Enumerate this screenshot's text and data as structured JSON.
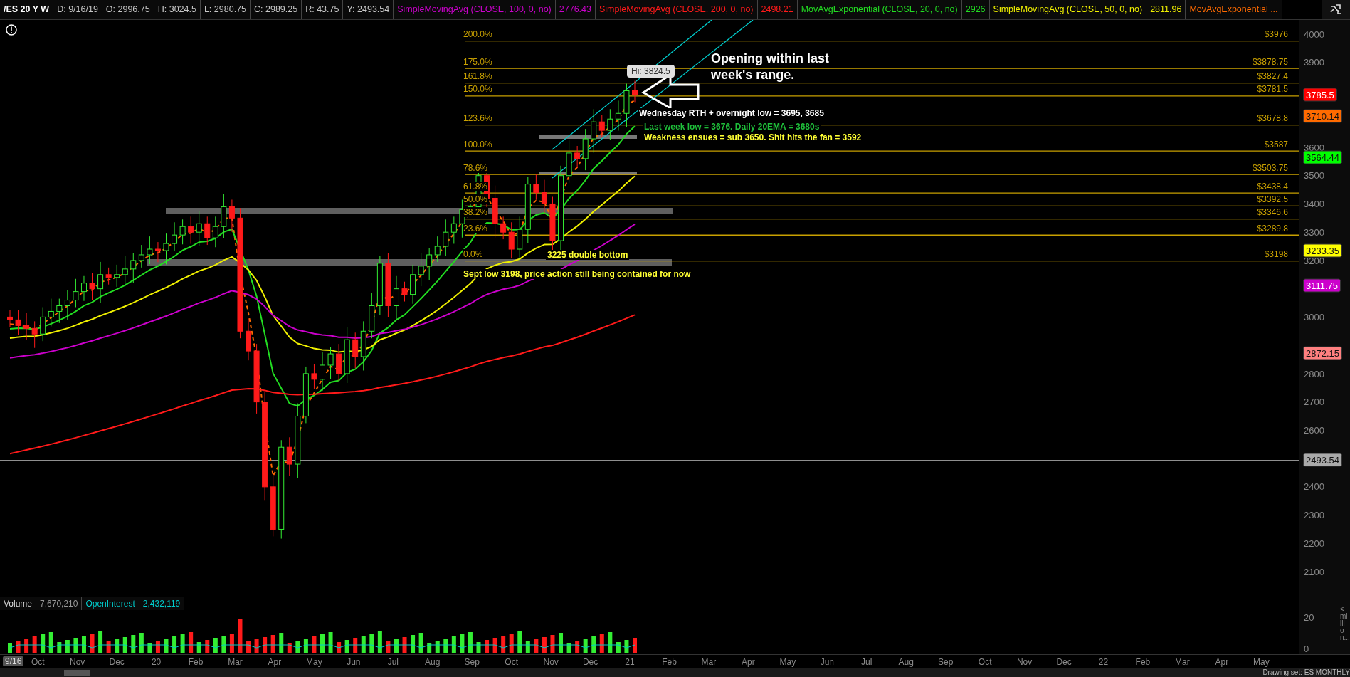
{
  "header": {
    "symbol": "/ES 20 Y W",
    "fields": [
      "D: 9/16/19",
      "O: 2996.75",
      "H: 3024.5",
      "L: 2980.75",
      "C: 2989.25",
      "R: 43.75",
      "Y: 2493.54"
    ],
    "studies": [
      {
        "name": "SimpleMovingAvg (CLOSE, 100, 0, no)",
        "value": "2776.43",
        "color": "#cc00cc"
      },
      {
        "name": "SimpleMovingAvg (CLOSE, 200, 0, no)",
        "value": "2498.21",
        "color": "#ff1a1a"
      },
      {
        "name": "MovAvgExponential (CLOSE, 20, 0, no)",
        "value": "2926",
        "color": "#22dd22"
      },
      {
        "name": "SimpleMovingAvg (CLOSE, 50, 0, no)",
        "value": "2811.96",
        "color": "#f0f000"
      },
      {
        "name": "MovAvgExponential ...",
        "color": "#ff6a00"
      }
    ]
  },
  "chart": {
    "fib_levels": [
      {
        "percent": "200.0%",
        "price": "$3976"
      },
      {
        "percent": "175.0%",
        "price": "$3878.75"
      },
      {
        "percent": "161.8%",
        "price": "$3827.4"
      },
      {
        "percent": "150.0%",
        "price": "$3781.5"
      },
      {
        "percent": "123.6%",
        "price": "$3678.8"
      },
      {
        "percent": "100.0%",
        "price": "$3587"
      },
      {
        "percent": "78.6%",
        "price": "$3503.75"
      },
      {
        "percent": "61.8%",
        "price": "$3438.4"
      },
      {
        "percent": "50.0%",
        "price": "$3392.5"
      },
      {
        "percent": "38.2%",
        "price": "$3346.6"
      },
      {
        "percent": "23.6%",
        "price": "$3289.8"
      },
      {
        "percent": "0.0%",
        "price": "$3198"
      }
    ],
    "price_ticks": [
      "4000",
      "3900",
      "3600",
      "3500",
      "3400",
      "3300",
      "3200",
      "3000",
      "2800",
      "2700",
      "2600",
      "2400",
      "2300",
      "2200",
      "2100"
    ],
    "price_tags": [
      {
        "text": "3785.5",
        "color": "#ff0000",
        "kind": "study"
      },
      {
        "text": "3710.14",
        "color": "#ff6a00",
        "kind": "study"
      },
      {
        "text": "3564.44",
        "color": "#00ff00",
        "kind": "study"
      },
      {
        "text": "3233.35",
        "color": "#ffff00",
        "kind": "study"
      },
      {
        "text": "3111.75",
        "color": "#cc00cc",
        "kind": "study"
      },
      {
        "text": "2872.15",
        "color": "#ff8080",
        "kind": "study"
      },
      {
        "text": "2493.54",
        "color": "#aaaaaa",
        "kind": "price-line"
      }
    ],
    "annotations": [
      {
        "text": "Hi: 3824.5",
        "kind": "bubble",
        "color": "#e0e0e0"
      },
      {
        "text": "Opening within last week's range.",
        "kind": "headline",
        "color": "#ffffff"
      },
      {
        "text": "Wednesday RTH + overnight low = 3695, 3685",
        "kind": "note",
        "color": "#ffffff"
      },
      {
        "text": "Last week low = 3676. Daily 20EMA = 3680s",
        "kind": "note",
        "color": "#1fbf3a"
      },
      {
        "text": "Weakness ensues = sub 3650. Shit hits the fan = 3592",
        "kind": "note",
        "color": "#ffff33"
      },
      {
        "text": "3225 double bottom",
        "kind": "note",
        "color": "#ffff33"
      },
      {
        "text": "Sept low 3198, price action still being contained for now",
        "kind": "note",
        "color": "#ffff33"
      }
    ]
  },
  "volume": {
    "readouts": [
      {
        "label": "Volume",
        "value": "7,670,210"
      },
      {
        "label": "OpenInterest",
        "value": "2,432,119"
      }
    ],
    "ticks": [
      "20",
      "0"
    ],
    "units": "<million..."
  },
  "x_axis": {
    "current": "9/16",
    "months": [
      "Oct",
      "Nov",
      "Dec",
      "20",
      "Feb",
      "Mar",
      "Apr",
      "May",
      "Jun",
      "Jul",
      "Aug",
      "Sep",
      "Oct",
      "Nov",
      "Dec",
      "21",
      "Feb",
      "Mar",
      "Apr",
      "May",
      "Jun",
      "Jul",
      "Aug",
      "Sep",
      "Oct",
      "Nov",
      "Dec",
      "22",
      "Feb",
      "Mar",
      "Apr",
      "May"
    ]
  },
  "status": {
    "drawing_set": "Drawing set: ES MONTHLY"
  }
}
